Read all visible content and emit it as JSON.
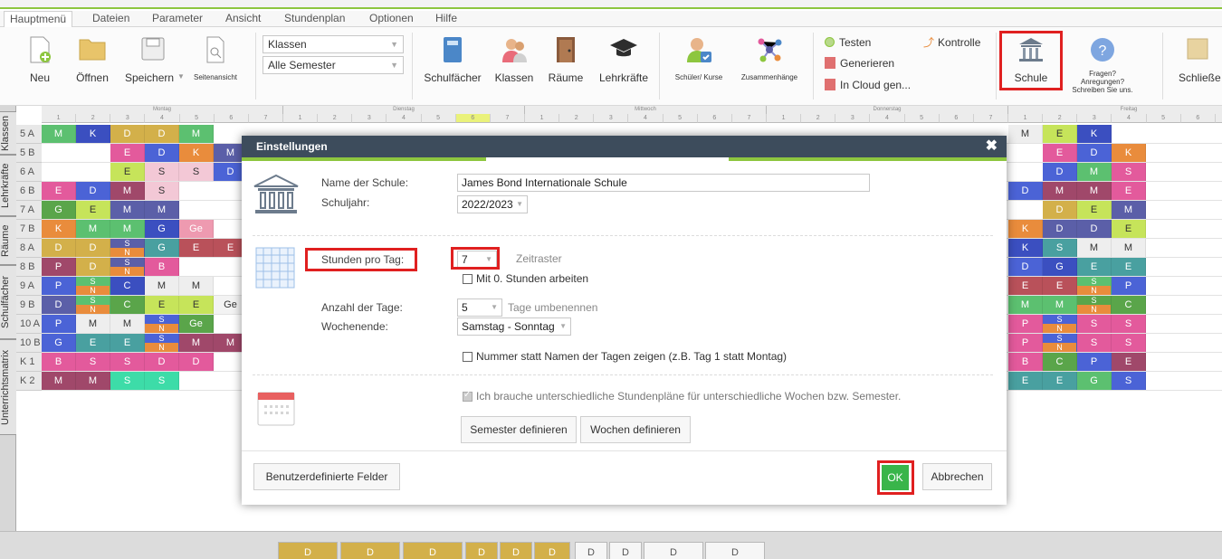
{
  "menu": {
    "items": [
      "Hauptmenü",
      "Dateien",
      "Parameter",
      "Ansicht",
      "Stundenplan",
      "Optionen",
      "Hilfe"
    ]
  },
  "ribbon": {
    "file_buttons": [
      "Neu",
      "Öffnen",
      "Speichern",
      "Seitenansicht"
    ],
    "select_klassen": "Klassen",
    "select_semester": "Alle Semester",
    "data_buttons": [
      "Schulfächer",
      "Klassen",
      "Räume",
      "Lehrkräfte"
    ],
    "small_buttons": [
      "Schüler/ Kurse",
      "Zusammenhänge"
    ],
    "links": [
      "Testen",
      "Generieren",
      "In Cloud gen...",
      "Kontrolle"
    ],
    "schule_label": "Schule",
    "fragen_lines": [
      "Fragen?",
      "Anregungen?",
      "Schreiben Sie uns."
    ],
    "schliessen_label": "Schließe"
  },
  "side_tabs": [
    "Klassen",
    "Lehrkräfte",
    "Räume",
    "Schulfächer",
    "Unterrichtsmatrix"
  ],
  "days": [
    "Montag",
    "Dienstag",
    "Mittwoch",
    "Donnerstag",
    "Freitag"
  ],
  "periods": [
    "1",
    "2",
    "3",
    "4",
    "5",
    "6",
    "7"
  ],
  "classes": [
    "5 A",
    "5 B",
    "6 A",
    "6 B",
    "7 A",
    "7 B",
    "8 A",
    "8 B",
    "9 A",
    "9 B",
    "10 A",
    "10 B",
    "K 1",
    "K 2"
  ],
  "lessons_left": [
    [
      [
        "M",
        "#5cc070"
      ],
      [
        "K",
        "#3b4fc0"
      ],
      [
        "D",
        "#d3b04a"
      ],
      [
        "D",
        "#d3b04a"
      ],
      [
        "M",
        "#5cc070"
      ]
    ],
    [
      [
        "",
        ""
      ],
      [
        "",
        ""
      ],
      [
        "E",
        "#e35a9c"
      ],
      [
        "D",
        "#4b63d6"
      ],
      [
        "K",
        "#e98c3c"
      ],
      [
        "M",
        "#5b5fa8"
      ]
    ],
    [
      [
        "",
        ""
      ],
      [
        "",
        ""
      ],
      [
        "E",
        "#c6e45a"
      ],
      [
        "S",
        "#f3c8d6"
      ],
      [
        "S",
        "#f3c8d6"
      ],
      [
        "D",
        "#4b63d6"
      ]
    ],
    [
      [
        "E",
        "#e35a9c"
      ],
      [
        "D",
        "#4b63d6"
      ],
      [
        "M",
        "#a0486a"
      ],
      [
        "S",
        "#f3c8d6"
      ],
      [
        "",
        ""
      ],
      [
        "",
        ""
      ]
    ],
    [
      [
        "G",
        "#5aa54a"
      ],
      [
        "E",
        "#c6e45a"
      ],
      [
        "M",
        "#5b5fa8"
      ],
      [
        "M",
        "#5b5fa8"
      ],
      [
        "",
        ""
      ],
      [
        "",
        ""
      ]
    ],
    [
      [
        "K",
        "#e98c3c"
      ],
      [
        "M",
        "#5cc070"
      ],
      [
        "M",
        "#5cc070"
      ],
      [
        "G",
        "#3b4fc0"
      ],
      [
        "Ge",
        "#ee9ab0"
      ],
      [
        "",
        ""
      ]
    ],
    [
      [
        "D",
        "#d3b04a"
      ],
      [
        "D",
        "#d3b04a"
      ],
      [
        "S/N",
        "#5b5fa8"
      ],
      [
        "G",
        "#49a0a0"
      ],
      [
        "E",
        "#b9515a"
      ],
      [
        "E",
        "#b9515a"
      ]
    ],
    [
      [
        "P",
        "#a0486a"
      ],
      [
        "D",
        "#d3b04a"
      ],
      [
        "S/N",
        "#5b5fa8"
      ],
      [
        "B",
        "#e35a9c"
      ],
      [
        "",
        ""
      ],
      [
        "",
        ""
      ]
    ],
    [
      [
        "P",
        "#4b63d6"
      ],
      [
        "S/N",
        "#5cc070"
      ],
      [
        "C",
        "#3b4fc0"
      ],
      [
        "M",
        "#eeeeee"
      ],
      [
        "M",
        "#eeeeee"
      ],
      [
        "",
        ""
      ]
    ],
    [
      [
        "D",
        "#5b5fa8"
      ],
      [
        "S/N",
        "#5cc070"
      ],
      [
        "C",
        "#5aa54a"
      ],
      [
        "E",
        "#c6e45a"
      ],
      [
        "E",
        "#c6e45a"
      ],
      [
        "Ge",
        "#f3f3f3"
      ]
    ],
    [
      [
        "P",
        "#4b63d6"
      ],
      [
        "M",
        "#eeeeee"
      ],
      [
        "M",
        "#eeeeee"
      ],
      [
        "S/N",
        "#4b63d6"
      ],
      [
        "Ge",
        "#5aa54a"
      ],
      [
        "",
        ""
      ]
    ],
    [
      [
        "G",
        "#4b63d6"
      ],
      [
        "E",
        "#49a0a0"
      ],
      [
        "E",
        "#49a0a0"
      ],
      [
        "S/N",
        "#4b63d6"
      ],
      [
        "M",
        "#a0486a"
      ],
      [
        "M",
        "#a0486a"
      ]
    ],
    [
      [
        "B",
        "#e35a9c"
      ],
      [
        "S",
        "#e35a9c"
      ],
      [
        "S",
        "#e35a9c"
      ],
      [
        "D",
        "#e35a9c"
      ],
      [
        "D",
        "#e35a9c"
      ],
      [
        "",
        ""
      ]
    ],
    [
      [
        "M",
        "#a0486a"
      ],
      [
        "M",
        "#a0486a"
      ],
      [
        "S",
        "#3ddca8"
      ],
      [
        "S",
        "#3ddca8"
      ],
      [
        "",
        ""
      ],
      [
        "",
        ""
      ]
    ]
  ],
  "lessons_right": [
    [
      [
        "M",
        "#eeeeee"
      ],
      [
        "E",
        "#c6e45a"
      ],
      [
        "K",
        "#3b4fc0"
      ]
    ],
    [
      [
        "",
        ""
      ],
      [
        "E",
        "#e35a9c"
      ],
      [
        "D",
        "#4b63d6"
      ],
      [
        "K",
        "#e98c3c"
      ]
    ],
    [
      [
        "",
        ""
      ],
      [
        "D",
        "#4b63d6"
      ],
      [
        "M",
        "#5cc070"
      ],
      [
        "S",
        "#e35a9c"
      ]
    ],
    [
      [
        "D",
        "#4b63d6"
      ],
      [
        "M",
        "#a0486a"
      ],
      [
        "M",
        "#a0486a"
      ],
      [
        "E",
        "#e35a9c"
      ]
    ],
    [
      [
        "",
        ""
      ],
      [
        "D",
        "#d3b04a"
      ],
      [
        "E",
        "#c6e45a"
      ],
      [
        "M",
        "#5b5fa8"
      ]
    ],
    [
      [
        "K",
        "#e98c3c"
      ],
      [
        "D",
        "#5b5fa8"
      ],
      [
        "D",
        "#5b5fa8"
      ],
      [
        "E",
        "#c6e45a"
      ]
    ],
    [
      [
        "K",
        "#3b4fc0"
      ],
      [
        "S",
        "#49a0a0"
      ],
      [
        "M",
        "#eeeeee"
      ],
      [
        "M",
        "#eeeeee"
      ]
    ],
    [
      [
        "D",
        "#4b63d6"
      ],
      [
        "G",
        "#3b4fc0"
      ],
      [
        "E",
        "#49a0a0"
      ],
      [
        "E",
        "#49a0a0"
      ]
    ],
    [
      [
        "E",
        "#b9515a"
      ],
      [
        "E",
        "#b9515a"
      ],
      [
        "S/N",
        "#5cc070"
      ],
      [
        "P",
        "#4b63d6"
      ]
    ],
    [
      [
        "M",
        "#5cc070"
      ],
      [
        "M",
        "#5cc070"
      ],
      [
        "S/N",
        "#5aa54a"
      ],
      [
        "C",
        "#5aa54a"
      ]
    ],
    [
      [
        "P",
        "#e35a9c"
      ],
      [
        "S/N",
        "#4b63d6"
      ],
      [
        "S",
        "#e35a9c"
      ],
      [
        "S",
        "#e35a9c"
      ]
    ],
    [
      [
        "P",
        "#e35a9c"
      ],
      [
        "S/N",
        "#4b63d6"
      ],
      [
        "S",
        "#e35a9c"
      ],
      [
        "S",
        "#e35a9c"
      ]
    ],
    [
      [
        "B",
        "#e35a9c"
      ],
      [
        "C",
        "#5aa54a"
      ],
      [
        "P",
        "#4b63d6"
      ],
      [
        "E",
        "#a0486a"
      ]
    ],
    [
      [
        "E",
        "#49a0a0"
      ],
      [
        "E",
        "#49a0a0"
      ],
      [
        "G",
        "#5cc070"
      ],
      [
        "S",
        "#4b63d6"
      ]
    ]
  ],
  "bottom_cells": [
    "D",
    "D",
    "D",
    "D",
    "D",
    "D",
    "D",
    "D",
    "D",
    "D"
  ],
  "dialog": {
    "title": "Einstellungen",
    "school_name_label": "Name der Schule:",
    "school_name_value": "James Bond Internationale Schule",
    "schuljahr_label": "Schuljahr:",
    "schuljahr_value": "2022/2023",
    "stunden_label": "Stunden pro Tag:",
    "stunden_value": "7",
    "zeitraster": "Zeitraster",
    "null_stunden": "Mit 0. Stunden arbeiten",
    "tage_label": "Anzahl der Tage:",
    "tage_value": "5",
    "tage_umbenennen": "Tage umbenennen",
    "wochenende_label": "Wochenende:",
    "wochenende_value": "Samstag - Sonntag",
    "nummer_check": "Nummer statt Namen der Tagen zeigen (z.B. Tag 1 statt Montag)",
    "unterschiedlich_check": "Ich brauche unterschiedliche Stundenpläne für unterschiedliche Wochen bzw. Semester.",
    "semester_btn": "Semester definieren",
    "wochen_btn": "Wochen definieren",
    "custom_fields_btn": "Benutzerdefinierte Felder",
    "ok_btn": "OK",
    "cancel_btn": "Abbrechen"
  },
  "colors": {
    "accent_green": "#8dc63f",
    "ok_green": "#39b54a",
    "highlight_red": "#e02020",
    "dialog_header": "#3d4c5c"
  }
}
